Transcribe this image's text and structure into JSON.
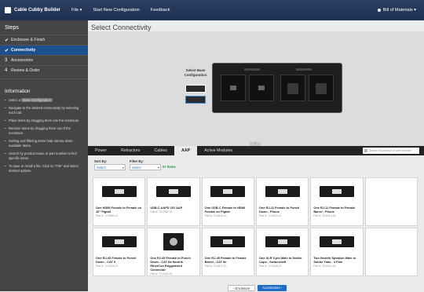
{
  "app": {
    "title": "Cable Cubby Builder",
    "menu": [
      "File ▾",
      "Start New Configuration",
      "Feedback"
    ],
    "bom_label": "Bill of Materials ▾"
  },
  "sidebar": {
    "heading": "Steps",
    "steps": [
      {
        "label": "Enclosure & Finish",
        "icon": "✔",
        "active": false
      },
      {
        "label": "Connectivity",
        "icon": "✔",
        "active": true
      },
      {
        "label": "Accessories",
        "icon": "3",
        "active": false
      },
      {
        "label": "Review & Order",
        "icon": "4",
        "active": false
      }
    ],
    "info_title": "Information",
    "info": [
      {
        "pre": "Select a ",
        "tag": "Base Configuration",
        "post": ""
      },
      {
        "pre": "Navigate to the desired connectivity by selecting each tab.",
        "tag": "",
        "post": ""
      },
      {
        "pre": "Place items by dragging them into the enclosure.",
        "tag": "",
        "post": ""
      },
      {
        "pre": "Remove items by dragging them out of the enclosure.",
        "tag": "",
        "post": ""
      },
      {
        "pre": "Sorting and filtering items help narrow down available items.",
        "tag": "",
        "post": ""
      },
      {
        "pre": "Search by product name or part number to find specific items.",
        "tag": "",
        "post": ""
      },
      {
        "pre": "To save or recall a file, Click on \"File\" and select desired options.",
        "tag": "",
        "post": ""
      }
    ]
  },
  "main": {
    "title": "Select Connectivity",
    "base_label": "Select Base Configuration",
    "collapse_icon": "chevron-up-icon"
  },
  "tabs": [
    {
      "label": "Power",
      "active": false
    },
    {
      "label": "Retractors",
      "active": false
    },
    {
      "label": "Cables",
      "active": false
    },
    {
      "label": "AAP",
      "active": true
    },
    {
      "label": "Active Modules",
      "active": false
    }
  ],
  "search": {
    "placeholder": "Search by product or part number"
  },
  "filters": {
    "sort_label": "Sort By:",
    "sort_value": "Select",
    "filter_label": "Filter By:",
    "filter_value": "Select",
    "count": "57 Items"
  },
  "products": [
    {
      "name": "One HDMI Female to Female on 10\" Pigtail",
      "part": "Part #: 72-0352-01",
      "shape": "wide"
    },
    {
      "name": "USB-C AAPD 101 AAP",
      "part": "Part #: 72-0351-01",
      "shape": "wide"
    },
    {
      "name": "One USB-C Female to HDMI Female on Pigtail",
      "part": "Part #: 72-0410-01",
      "shape": "wide"
    },
    {
      "name": "One RJ-11 Female to Punch Down - Phone",
      "part": "Part #: 72-0412-01",
      "shape": "wide"
    },
    {
      "name": "One RJ-11 Female to Female Barrel - Phone",
      "part": "Part #: 72-0413-01",
      "shape": "wide"
    },
    {
      "name": "",
      "part": "",
      "shape": "none"
    },
    {
      "name": "One RJ-45 Female to Punch Down - CAT 5",
      "part": "Part #: 72-0415-01",
      "shape": "wide"
    },
    {
      "name": "One RJ-45 Female to Punch Down - CAT 6a Neutrik EtherCon Ruggedized Connector",
      "part": "Part #: 72-0416-01",
      "shape": "square"
    },
    {
      "name": "One RJ-45 Female to Female Barrel - CAT 5e",
      "part": "Part #: 72-0417-01",
      "shape": "wide"
    },
    {
      "name": "One XLR 3-pin Male to Solder Cups - Switchcraft",
      "part": "Part #: 72-0418-01",
      "shape": "wide"
    },
    {
      "name": "Two Neutrik Speakon Male to Solder Tabs - 4 Pole",
      "part": "Part #: 72-0419-01",
      "shape": "wide"
    },
    {
      "name": "",
      "part": "",
      "shape": "none"
    }
  ],
  "footer": {
    "prev": "‹ Enclosure",
    "next": "Accessories ›"
  }
}
